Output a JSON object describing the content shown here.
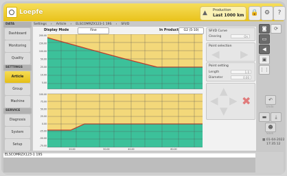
{
  "app": {
    "logo": "Loepfe"
  },
  "header": {
    "production_line1": "Production",
    "production_line2": "Last 1000 km"
  },
  "sidebar": {
    "sections": [
      {
        "title": "DATA",
        "items": [
          "Dashboard",
          "Monitoring",
          "Quality"
        ]
      },
      {
        "title": "SETTINGS",
        "items": [
          "Article",
          "Group",
          "Machine"
        ]
      },
      {
        "title": "SERVICE",
        "items": [
          "Diagnosis",
          "System",
          "Setup"
        ]
      }
    ],
    "active_item": "Article"
  },
  "breadcrumb": [
    "Settings",
    "Article",
    "ELSCOMRZX123-1 19S",
    "SFI/D"
  ],
  "controls": {
    "display_mode_label": "Display Mode",
    "display_mode_value": "Fine",
    "in_production_label": "In Production",
    "in_production_value": "G2 (5-10)"
  },
  "chart_data": {
    "type": "line",
    "x_ticks": [
      "20.00",
      "50.00",
      "40.00",
      "80.00"
    ],
    "upper_y_ticks": [
      "200.00",
      "150.00",
      "100.00",
      "50.00",
      "25.00",
      "10.00",
      "5.00"
    ],
    "lower_y_ticks": [
      "100.00",
      "75.00",
      "50.00",
      "25.00",
      "0.00",
      "-25.00",
      "-50.00",
      "-75.00"
    ],
    "colors": {
      "region_yellow": "#f3d87a",
      "region_green": "#3cc19a",
      "curve": "#c0392b"
    }
  },
  "side_panel": {
    "curve_title": "SFI/D Curve",
    "clearing_label": "Clearing",
    "clearing_value": "On",
    "point_selection_title": "Point selection",
    "point_setting_title": "Point setting",
    "length_label": "Length",
    "length_value": "1.0",
    "diameter_label": "Diameter",
    "diameter_value": "0.00"
  },
  "right_toolbar": {
    "undo_label": "Undo",
    "save_label": "Save"
  },
  "status": {
    "date": "01-04-2022",
    "time": "17:35:12"
  },
  "bottom": {
    "article_name": "ELSCOMRZX123-1 19S"
  }
}
